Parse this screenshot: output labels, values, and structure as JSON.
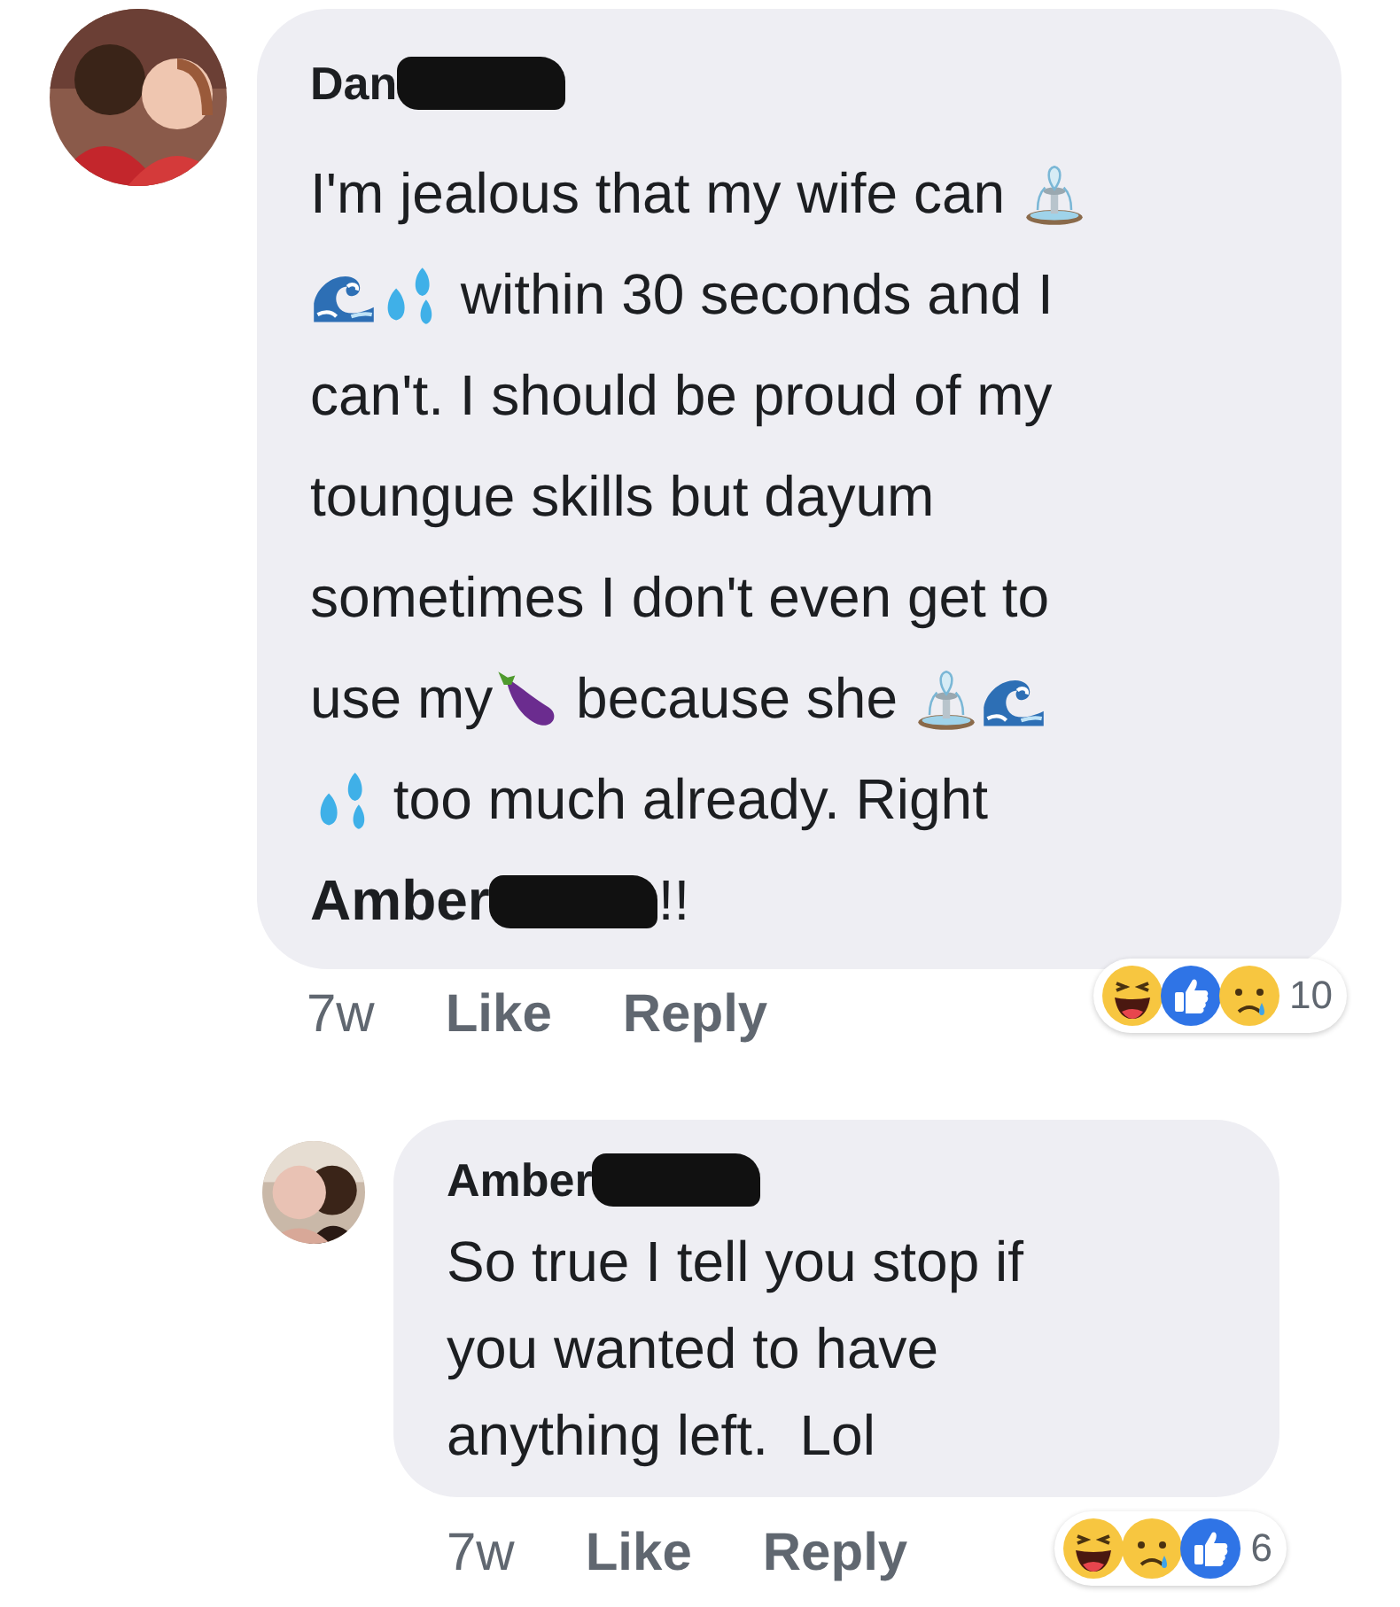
{
  "comments": [
    {
      "author": [
        {
          "kind": "text",
          "text": "Dan"
        },
        {
          "kind": "redaction"
        }
      ],
      "lines": [
        [
          {
            "kind": "text",
            "text": "I'm jealous that my wife can "
          },
          {
            "kind": "fountain"
          }
        ],
        [
          {
            "kind": "wave"
          },
          {
            "kind": "droplets"
          },
          {
            "kind": "text",
            "text": " within 30 seconds and I"
          }
        ],
        [
          {
            "kind": "text",
            "text": "can't. I should be proud of my"
          }
        ],
        [
          {
            "kind": "text",
            "text": "toungue skills but dayum"
          }
        ],
        [
          {
            "kind": "text",
            "text": "sometimes I don't even get to"
          }
        ],
        [
          {
            "kind": "text",
            "text": "use my"
          },
          {
            "kind": "eggplant"
          },
          {
            "kind": "text",
            "text": " because she "
          },
          {
            "kind": "fountain"
          },
          {
            "kind": "wave"
          }
        ],
        [
          {
            "kind": "droplets"
          },
          {
            "kind": "text",
            "text": " too much already. Right"
          }
        ],
        [
          {
            "kind": "mention",
            "text": "Amber"
          },
          {
            "kind": "redaction"
          },
          {
            "kind": "text",
            "text": "!!"
          }
        ]
      ],
      "time": "7w",
      "actions": [
        "Like",
        "Reply"
      ],
      "reactions": [
        {
          "kind": "haha"
        },
        {
          "kind": "like"
        },
        {
          "kind": "sad"
        }
      ],
      "reaction_count": "10",
      "children": [
        {
          "author": [
            {
              "kind": "text",
              "text": "Amber"
            },
            {
              "kind": "redaction"
            }
          ],
          "lines": [
            [
              {
                "kind": "text",
                "text": "So true I tell you stop if"
              }
            ],
            [
              {
                "kind": "text",
                "text": "you wanted to have"
              }
            ],
            [
              {
                "kind": "text",
                "text": "anything left.  Lol"
              }
            ]
          ],
          "time": "7w",
          "actions": [
            "Like",
            "Reply"
          ],
          "reactions": [
            {
              "kind": "haha"
            },
            {
              "kind": "sad"
            },
            {
              "kind": "like"
            }
          ],
          "reaction_count": "6"
        }
      ]
    }
  ]
}
